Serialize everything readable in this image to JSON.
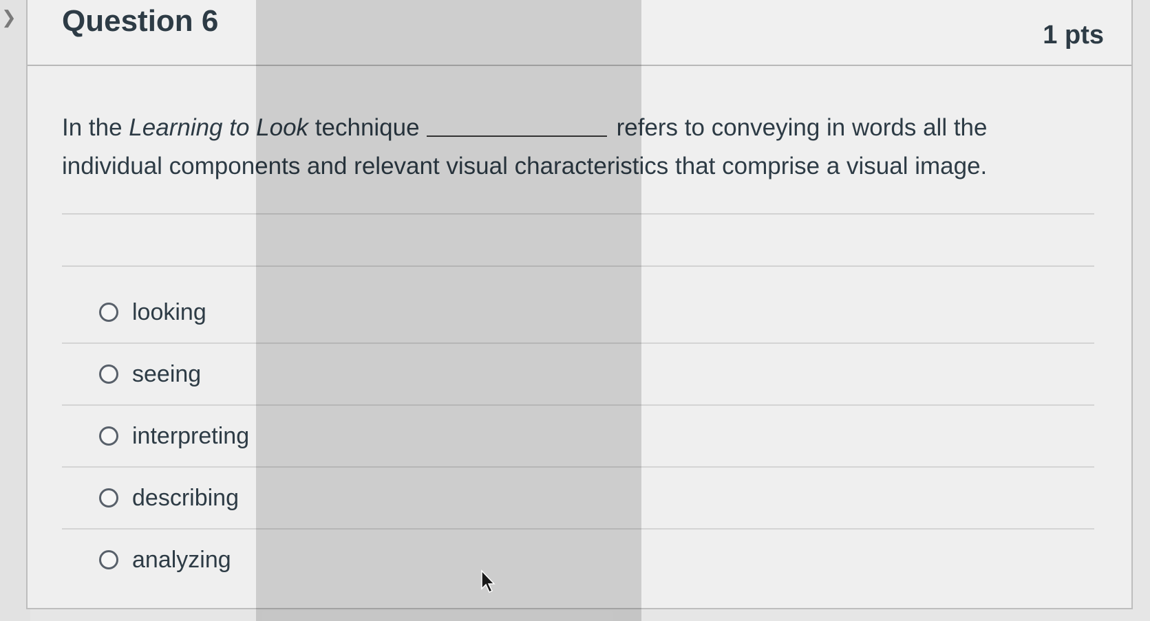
{
  "question": {
    "title": "Question 6",
    "points": "1 pts",
    "text_part1": "In the ",
    "text_italic": "Learning to Look",
    "text_part2": " technique",
    "text_part3": "refers to conveying in words all the individual components and relevant visual characteristics that comprise a visual image."
  },
  "answers": [
    {
      "label": "looking"
    },
    {
      "label": "seeing"
    },
    {
      "label": "interpreting"
    },
    {
      "label": "describing"
    },
    {
      "label": "analyzing"
    }
  ],
  "icons": {
    "chevron": "chevron-right-icon",
    "radio": "radio-icon",
    "cursor": "mouse-pointer-icon"
  },
  "colors": {
    "text": "#2d3b45",
    "card_bg": "#efefef",
    "border": "#bdbdbd"
  }
}
